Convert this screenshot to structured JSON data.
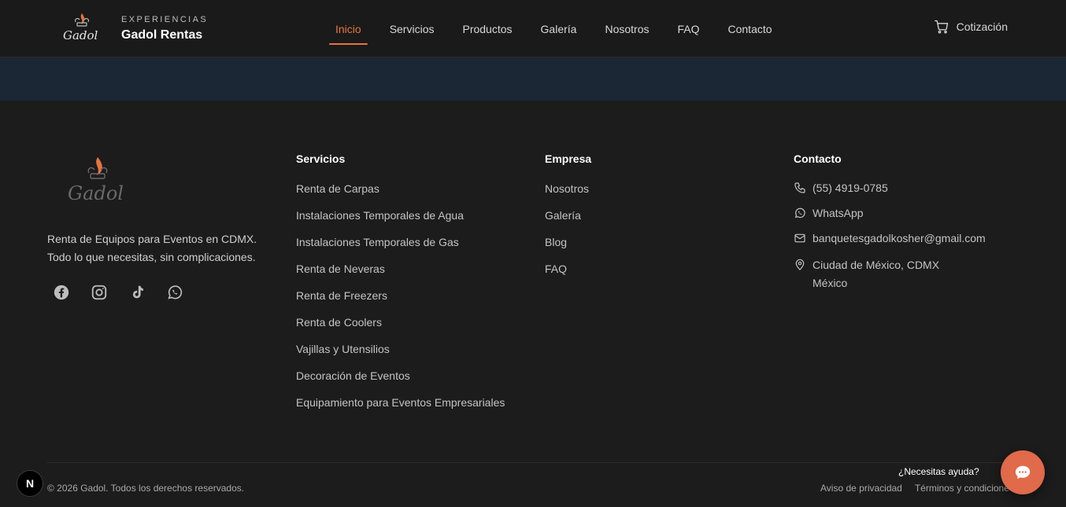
{
  "brand": {
    "kicker": "EXPERIENCIAS",
    "name": "Gadol Rentas",
    "logo_text": "Gadol",
    "accent": "#e8733e"
  },
  "nav": {
    "items": [
      {
        "label": "Inicio",
        "active": true
      },
      {
        "label": "Servicios",
        "active": false
      },
      {
        "label": "Productos",
        "active": false
      },
      {
        "label": "Galería",
        "active": false
      },
      {
        "label": "Nosotros",
        "active": false
      },
      {
        "label": "FAQ",
        "active": false
      },
      {
        "label": "Contacto",
        "active": false
      }
    ],
    "quote_label": "Cotización",
    "quote_icon": "cart-icon"
  },
  "footer": {
    "tagline": "Renta de Equipos para Eventos en CDMX. Todo lo que necesitas, sin complicaciones.",
    "socials": [
      "facebook-icon",
      "instagram-icon",
      "tiktok-icon",
      "whatsapp-icon"
    ],
    "servicios": {
      "title": "Servicios",
      "links": [
        "Renta de Carpas",
        "Instalaciones Temporales de Agua",
        "Instalaciones Temporales de Gas",
        "Renta de Neveras",
        "Renta de Freezers",
        "Renta de Coolers",
        "Vajillas y Utensilios",
        "Decoración de Eventos",
        "Equipamiento para Eventos Empresariales"
      ]
    },
    "empresa": {
      "title": "Empresa",
      "links": [
        "Nosotros",
        "Galería",
        "Blog",
        "FAQ"
      ]
    },
    "contacto": {
      "title": "Contacto",
      "phone": "(55) 4919-0785",
      "whatsapp": "WhatsApp",
      "email": "banquetesgadolkosher@gmail.com",
      "address_line1": "Ciudad de México, CDMX",
      "address_line2": "México"
    },
    "copyright": "© 2026 Gadol. Todos los derechos reservados.",
    "legal": [
      "Aviso de privacidad",
      "Términos y condiciones"
    ]
  },
  "widgets": {
    "next_badge": "N",
    "help_label": "¿Necesitas ayuda?",
    "chat_icon": "chat-bubble-icon",
    "chat_color": "#e06a4a"
  },
  "colors": {
    "header_bg": "#1a1a1a",
    "band_bg": "#1b2735",
    "footer_bg": "#1c1c1c"
  }
}
